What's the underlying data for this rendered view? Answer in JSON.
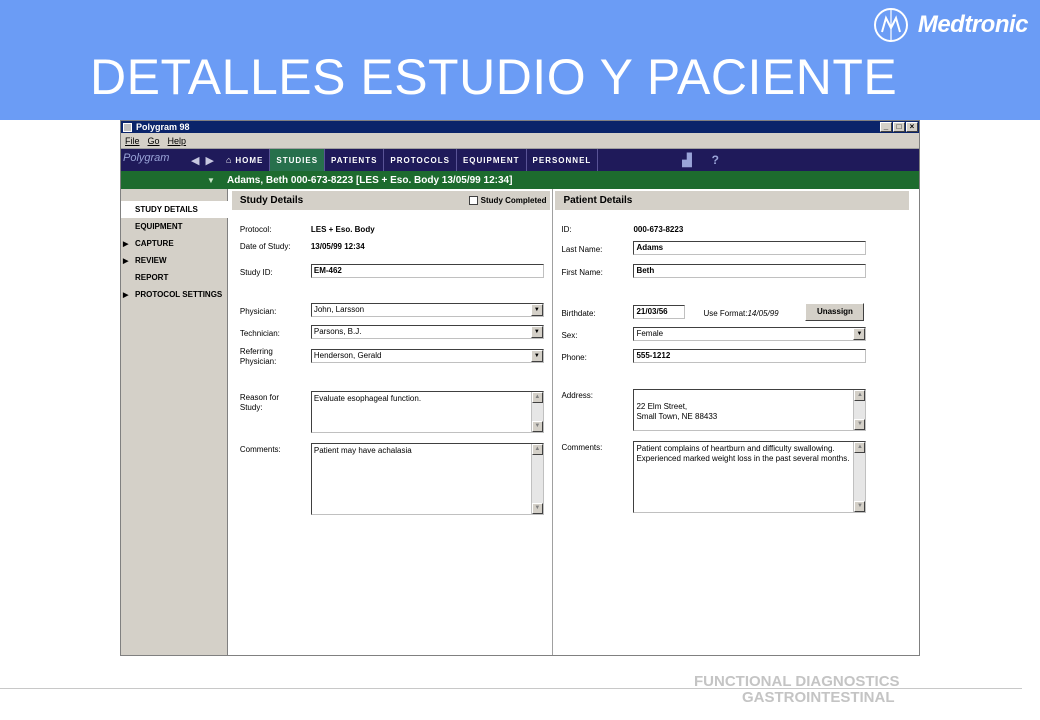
{
  "slide": {
    "title": "DETALLES ESTUDIO Y PACIENTE",
    "brand": "Medtronic",
    "footer_line1": "FUNCTIONAL DIAGNOSTICS",
    "footer_line2": "GASTROINTESTINAL"
  },
  "window": {
    "title": "Polygram 98",
    "controls": [
      "_",
      "□",
      "×"
    ]
  },
  "menu": [
    "File",
    "Go",
    "Help"
  ],
  "nav": {
    "logo": "Polygram",
    "tabs": [
      "HOME",
      "STUDIES",
      "PATIENTS",
      "PROTOCOLS",
      "EQUIPMENT",
      "PERSONNEL"
    ],
    "active_tab": "STUDIES",
    "help_glyph": "?"
  },
  "patient_bar": "Adams, Beth 000-673-8223 [LES + Eso. Body 13/05/99 12:34]",
  "sidebar": [
    {
      "label": "STUDY DETAILS",
      "arrow": ""
    },
    {
      "label": "EQUIPMENT",
      "arrow": ""
    },
    {
      "label": "CAPTURE",
      "arrow": "▶"
    },
    {
      "label": "REVIEW",
      "arrow": "▶"
    },
    {
      "label": "REPORT",
      "arrow": ""
    },
    {
      "label": "PROTOCOL SETTINGS",
      "arrow": "▶"
    }
  ],
  "study": {
    "header": "Study Details",
    "completed_label": "Study Completed",
    "protocol_label": "Protocol:",
    "protocol": "LES + Eso. Body",
    "date_label": "Date of Study:",
    "date": "13/05/99 12:34",
    "study_id_label": "Study ID:",
    "study_id": "EM-462",
    "physician_label": "Physician:",
    "physician": "John, Larsson",
    "technician_label": "Technician:",
    "technician": "Parsons, B.J.",
    "referring_label": "Referring Physician:",
    "referring": "Henderson, Gerald",
    "reason_label": "Reason for Study:",
    "reason": "Evaluate esophageal function.",
    "comments_label": "Comments:",
    "comments": "Patient may have achalasia"
  },
  "patient": {
    "header": "Patient Details",
    "id_label": "ID:",
    "id": "000-673-8223",
    "last_label": "Last Name:",
    "last": "Adams",
    "first_label": "First Name:",
    "first": "Beth",
    "birth_label": "Birthdate:",
    "birth": "21/03/56",
    "format_label": "Use Format:",
    "format": "14/05/99",
    "unassign": "Unassign",
    "sex_label": "Sex:",
    "sex": "Female",
    "phone_label": "Phone:",
    "phone": "555-1212",
    "address_label": "Address:",
    "address": "22 Elm Street,\nSmall Town, NE 88433",
    "comments_label": "Comments:",
    "comments": "Patient complains of heartburn and difficulty swallowing.  Experienced marked weight loss in the past several months."
  }
}
